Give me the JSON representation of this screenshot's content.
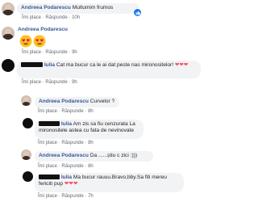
{
  "actions": {
    "like": "Îmi place",
    "reply": "Răspunde",
    "sep": "·"
  },
  "comments": [
    {
      "name": "Andreea Podarescu",
      "text": "Multumim frumos",
      "time": "10h"
    },
    {
      "name": "Andreea Podarescu",
      "text": "",
      "time": "9h"
    },
    {
      "name": "Iulia",
      "text": "Cat ma bucur ca le ai dat peste nas mironositelor!",
      "time": "9h"
    },
    {
      "name": "Andreea Podarescu",
      "text": "Curvelor ?",
      "time": "8h"
    },
    {
      "name": "Iulia",
      "text": "Am zis sa fiu cenzurata La mironositele astea cu fata de nevinovate",
      "time": "8h"
    },
    {
      "name": "Andreea Podarescu",
      "text": "Da ......știu c zici :)))",
      "time": "8h"
    },
    {
      "name": "Iulia",
      "text": "Ma bucur rauuu.Bravo,bby.Sa fiti mereu fericiti pup",
      "time": "7h"
    }
  ],
  "colors": {
    "name": "#385898",
    "bubble": "#f2f3f5",
    "like": "#1877f2",
    "heart": "#f25268"
  },
  "icons": {
    "like": "thumbs-up-icon",
    "heart": "heart-icon",
    "emoji": "heart-eyes-emoji-icon"
  }
}
